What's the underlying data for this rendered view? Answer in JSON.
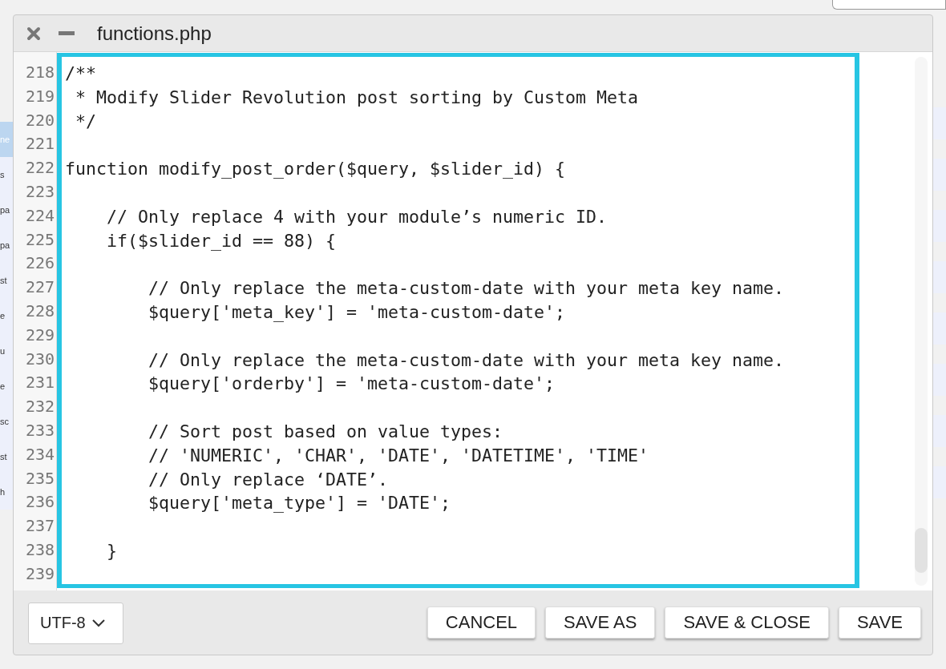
{
  "background_list": [
    {
      "text": "ne",
      "selected": true
    },
    {
      "text": "s",
      "selected": false
    },
    {
      "text": "pa",
      "selected": false
    },
    {
      "text": "pa",
      "selected": false
    },
    {
      "text": "st",
      "selected": false
    },
    {
      "text": "e",
      "selected": false
    },
    {
      "text": "u",
      "selected": false
    },
    {
      "text": "e",
      "selected": false
    },
    {
      "text": "sc",
      "selected": false
    },
    {
      "text": "st",
      "selected": false
    },
    {
      "text": "h",
      "selected": false
    }
  ],
  "dialog": {
    "title": "functions.php"
  },
  "editor": {
    "lines": [
      {
        "number": "218",
        "code": "/**"
      },
      {
        "number": "219",
        "code": " * Modify Slider Revolution post sorting by Custom Meta"
      },
      {
        "number": "220",
        "code": " */"
      },
      {
        "number": "221"
      },
      {
        "number": "222",
        "code": "function modify_post_order($query, $slider_id) {"
      },
      {
        "number": "223"
      },
      {
        "number": "224",
        "code": "    // Only replace 4 with your module’s numeric ID."
      },
      {
        "number": "225",
        "code": "    if($slider_id == 88) {"
      },
      {
        "number": "226"
      },
      {
        "number": "227",
        "code": "        // Only replace the meta-custom-date with your meta key name."
      },
      {
        "number": "228",
        "code": "        $query['meta_key'] = 'meta-custom-date';"
      },
      {
        "number": "229"
      },
      {
        "number": "230",
        "code": "        // Only replace the meta-custom-date with your meta key name."
      },
      {
        "number": "231",
        "code": "        $query['orderby'] = 'meta-custom-date';"
      },
      {
        "number": "232"
      },
      {
        "number": "233",
        "code": "        // Sort post based on value types:"
      },
      {
        "number": "234",
        "code": "        // 'NUMERIC', 'CHAR', 'DATE', 'DATETIME', 'TIME'"
      },
      {
        "number": "235",
        "code": "        // Only replace ‘DATE’."
      },
      {
        "number": "236",
        "code": "        $query['meta_type'] = 'DATE';"
      },
      {
        "number": "237"
      },
      {
        "number": "238",
        "code": "    }"
      },
      {
        "number": "239"
      }
    ]
  },
  "footer": {
    "encoding": "UTF-8",
    "buttons": [
      "CANCEL",
      "SAVE AS",
      "SAVE & CLOSE",
      "SAVE"
    ]
  }
}
